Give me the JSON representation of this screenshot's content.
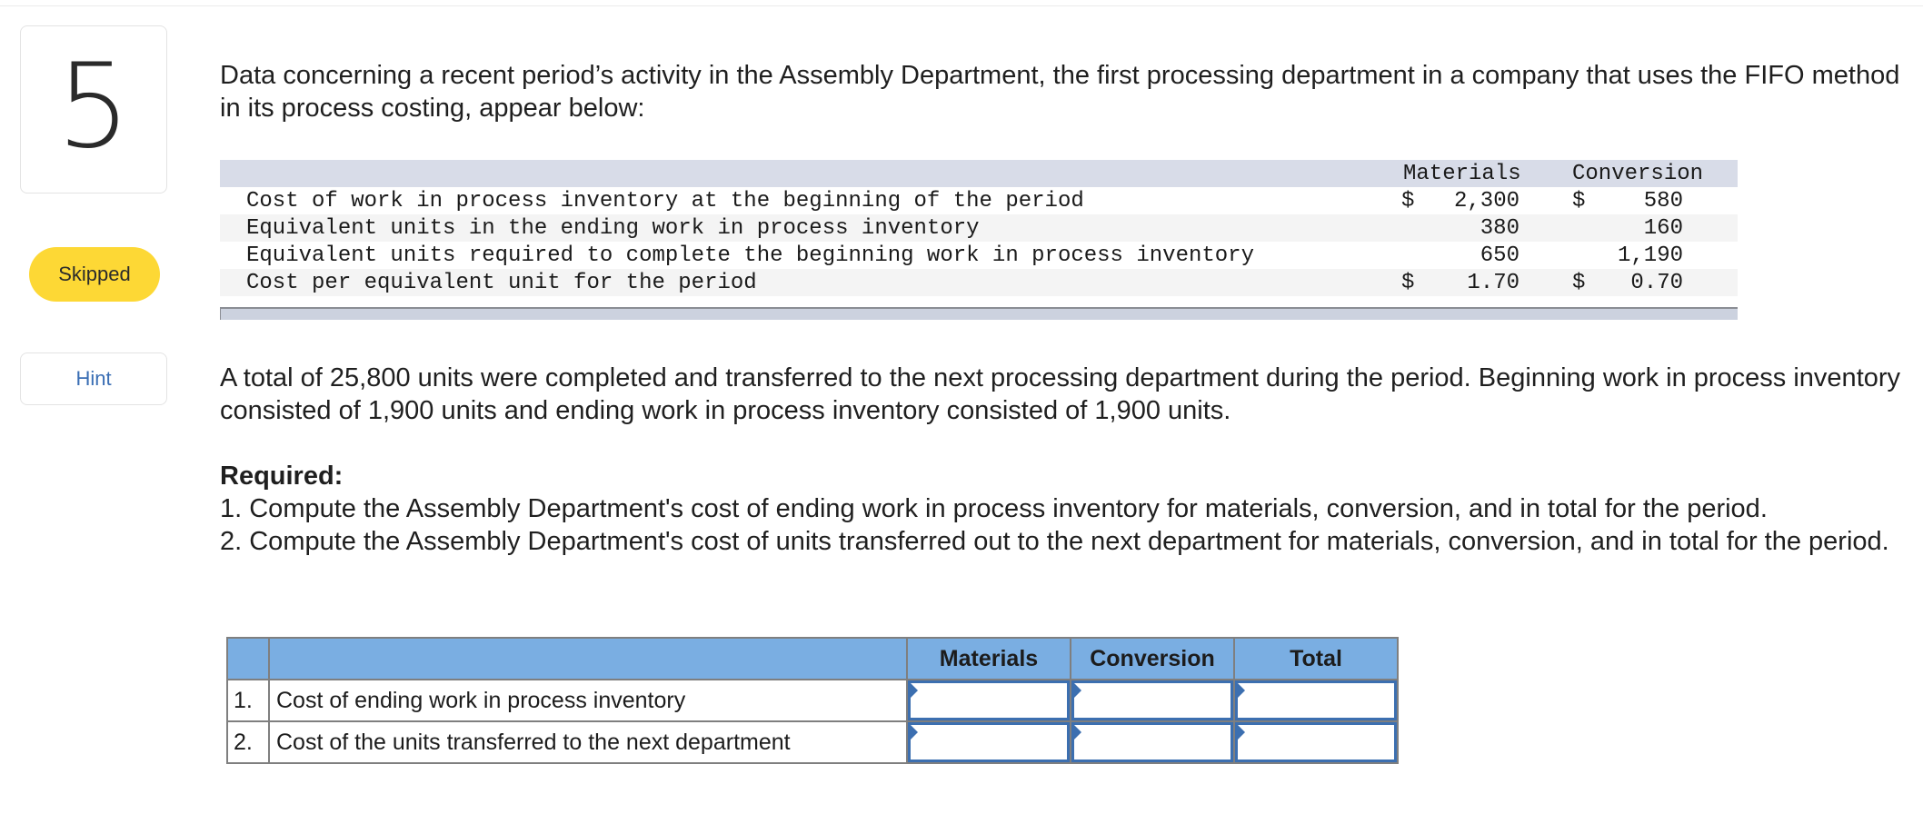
{
  "question": {
    "number": "5",
    "status": "Skipped",
    "hint_label": "Hint"
  },
  "intro": "Data concerning a recent period’s activity in the Assembly Department, the first processing department in a company that uses the FIFO method in its process costing, appear below:",
  "data_table": {
    "headers": {
      "materials": "Materials",
      "conversion": "Conversion"
    },
    "rows": [
      {
        "label": "Cost of work in process inventory at the beginning of the period",
        "materials_sym": "$",
        "materials": "2,300",
        "conversion_sym": "$",
        "conversion": "580"
      },
      {
        "label": "Equivalent units in the ending work in process inventory",
        "materials_sym": "",
        "materials": "380",
        "conversion_sym": "",
        "conversion": "160"
      },
      {
        "label": "Equivalent units required to complete the beginning work in process inventory",
        "materials_sym": "",
        "materials": "650",
        "conversion_sym": "",
        "conversion": "1,190"
      },
      {
        "label": "Cost per equivalent unit for the period",
        "materials_sym": "$",
        "materials": "1.70",
        "conversion_sym": "$",
        "conversion": "0.70"
      }
    ]
  },
  "summary": "A total of 25,800 units were completed and transferred to the next processing department during the period. Beginning work in process inventory consisted of 1,900 units and ending work in process inventory consisted of 1,900 units.",
  "required": {
    "title": "Required:",
    "items": [
      "1. Compute the Assembly Department's cost of ending work in process inventory for materials, conversion, and in total for the period.",
      "2. Compute the Assembly Department's cost of units transferred out to the next department for materials, conversion, and in total for the period."
    ]
  },
  "answer_table": {
    "headers": [
      "",
      "",
      "Materials",
      "Conversion",
      "Total"
    ],
    "rows": [
      {
        "num": "1.",
        "label": "Cost of ending work in process inventory",
        "materials": "",
        "conversion": "",
        "total": ""
      },
      {
        "num": "2.",
        "label": "Cost of the units transferred to the next department",
        "materials": "",
        "conversion": "",
        "total": ""
      }
    ]
  },
  "colors": {
    "status_badge": "#fdd835",
    "hint_text": "#3a6eb4",
    "answer_header": "#7aaee2",
    "input_border": "#3c6fb0",
    "data_header": "#d8dce8"
  }
}
